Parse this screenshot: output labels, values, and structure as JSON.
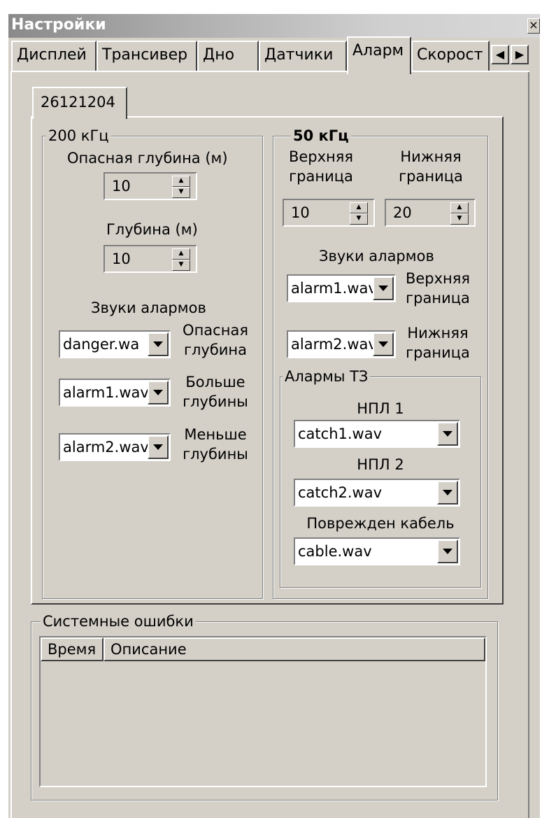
{
  "window": {
    "title": "Настройки",
    "close_glyph": "×"
  },
  "tabs": [
    {
      "label": "Дисплей"
    },
    {
      "label": "Трансивер"
    },
    {
      "label": "Дно"
    },
    {
      "label": "Датчики"
    },
    {
      "label": "Аларм"
    },
    {
      "label": "Скорост"
    }
  ],
  "active_tab": "Аларм",
  "tab_scroll": {
    "left": "◀",
    "right": "▶"
  },
  "subtab": {
    "label": "26121204"
  },
  "group_200": {
    "title": "200 кГц",
    "danger_depth_label": "Опасная глубина (м)",
    "danger_depth_value": "10",
    "depth_label": "Глубина (м)",
    "depth_value": "10",
    "sounds_label": "Звуки алармов",
    "sounds": [
      {
        "file": "danger.wa",
        "label_line1": "Опасная",
        "label_line2": "глубина"
      },
      {
        "file": "alarm1.wav",
        "label_line1": "Больше",
        "label_line2": "глубины"
      },
      {
        "file": "alarm2.wav",
        "label_line1": "Меньше",
        "label_line2": "глубины"
      }
    ]
  },
  "group_50": {
    "title": "50 кГц",
    "upper_label_line1": "Верхняя",
    "upper_label_line2": "граница",
    "lower_label_line1": "Нижняя",
    "lower_label_line2": "граница",
    "upper_value": "10",
    "lower_value": "20",
    "sounds_label": "Звуки алармов",
    "sounds": [
      {
        "file": "alarm1.wav",
        "label_line1": "Верхняя",
        "label_line2": "граница"
      },
      {
        "file": "alarm2.wav",
        "label_line1": "Нижняя",
        "label_line2": "граница"
      }
    ]
  },
  "group_tz": {
    "title": "Алармы ТЗ",
    "npl1_label": "НПЛ 1",
    "npl1_file": "catch1.wav",
    "npl2_label": "НПЛ 2",
    "npl2_file": "catch2.wav",
    "cable_label": "Поврежден кабель",
    "cable_file": "cable.wav"
  },
  "system_errors": {
    "title": "Системные ошибки",
    "columns": [
      "Время",
      "Описание"
    ]
  },
  "icons": {
    "spin_up": "▲",
    "spin_down": "▼"
  }
}
